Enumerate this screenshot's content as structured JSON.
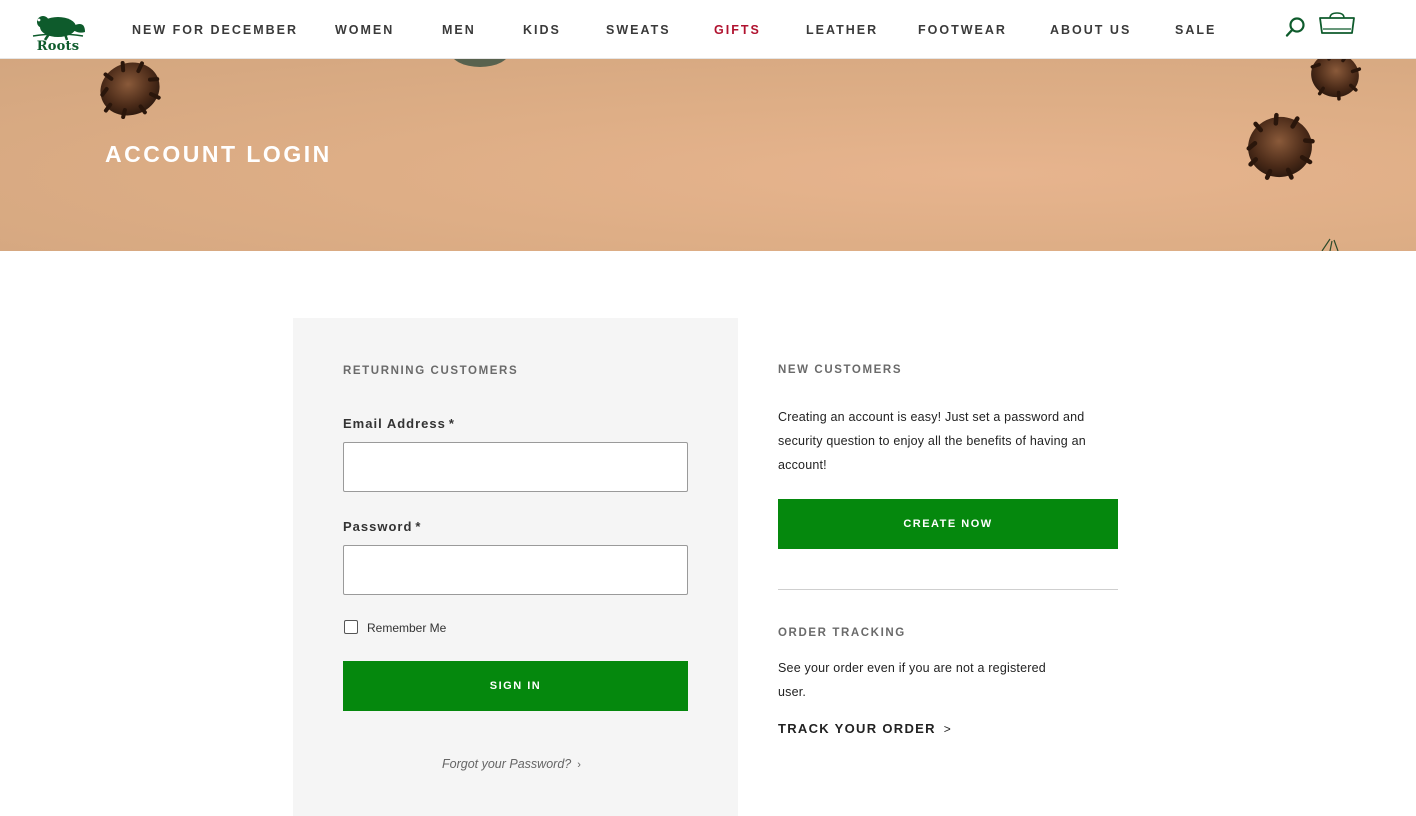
{
  "brand": {
    "name": "Roots",
    "color": "#0e5b2c"
  },
  "nav": {
    "items": [
      {
        "label": "NEW FOR DECEMBER"
      },
      {
        "label": "WOMEN"
      },
      {
        "label": "MEN"
      },
      {
        "label": "KIDS"
      },
      {
        "label": "SWEATS"
      },
      {
        "label": "GIFTS",
        "highlight_color": "#b0122f"
      },
      {
        "label": "LEATHER"
      },
      {
        "label": "FOOTWEAR"
      },
      {
        "label": "ABOUT US"
      },
      {
        "label": "SALE"
      }
    ],
    "search_icon": "search-icon",
    "cart_icon": "shopping-bag-icon"
  },
  "hero": {
    "title": "ACCOUNT LOGIN"
  },
  "returning": {
    "heading": "RETURNING CUSTOMERS",
    "email_label": "Email Address",
    "password_label": "Password",
    "required_marker": "*",
    "email_value": "",
    "password_value": "",
    "remember_label": "Remember Me",
    "remember_checked": false,
    "sign_in_label": "SIGN IN",
    "forgot_label": "Forgot your Password?",
    "forgot_chevron": "›"
  },
  "new_customers": {
    "heading": "NEW CUSTOMERS",
    "text": "Creating an account is easy! Just set a password and security question to enjoy all the benefits of having an account!",
    "create_label": "CREATE NOW"
  },
  "order_tracking": {
    "heading": "ORDER TRACKING",
    "text": "See your order even if you are not a registered user.",
    "link_label": "TRACK YOUR ORDER",
    "link_chevron": ">"
  },
  "colors": {
    "primary_button": "#05880d",
    "hero_bg": "#deae86"
  }
}
